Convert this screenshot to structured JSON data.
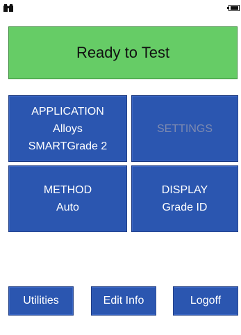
{
  "status_bar": {
    "left_icon": "binoculars-icon",
    "right_icon": "battery-icon"
  },
  "banner": {
    "status_text": "Ready to Test",
    "color": "#66cc66"
  },
  "tiles": {
    "application": {
      "title": "APPLICATION",
      "line1": "Alloys",
      "line2": "SMARTGrade 2"
    },
    "settings": {
      "title": "SETTINGS",
      "enabled": false
    },
    "method": {
      "title": "METHOD",
      "line1": "Auto"
    },
    "display": {
      "title": "DISPLAY",
      "line1": "Grade ID"
    }
  },
  "buttons": {
    "utilities": "Utilities",
    "edit_info": "Edit Info",
    "logoff": "Logoff"
  },
  "colors": {
    "tile_blue": "#2b56b0",
    "disabled_text": "#7d8ab0"
  }
}
